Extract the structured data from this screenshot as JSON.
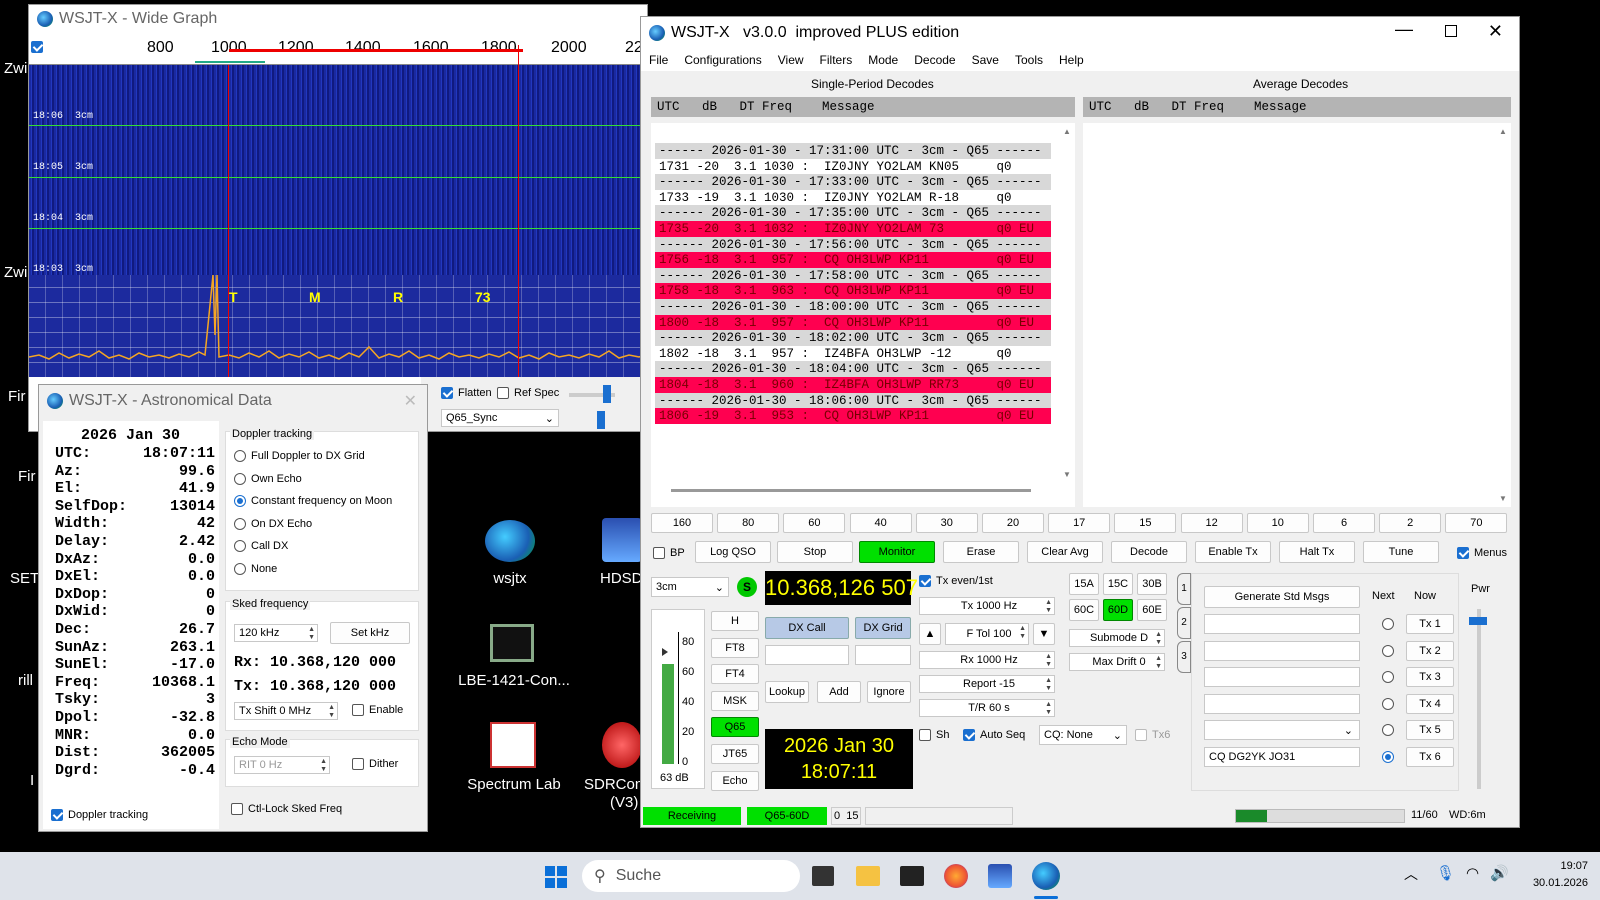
{
  "wide_graph": {
    "title": "WSJT-X - Wide Graph",
    "freq_ticks": [
      "800",
      "1000",
      "1200",
      "1400",
      "1600",
      "1800",
      "2000",
      "22"
    ],
    "time_labels": [
      "18:06  3cm",
      "18:05  3cm",
      "18:04  3cm",
      "18:03  3cm"
    ],
    "tone_labels": [
      "T",
      "M",
      "R",
      "73"
    ],
    "flatten_label": "Flatten",
    "ref_spec_label": "Ref Spec",
    "mode_select": "Q65_Sync",
    "left_edge_labels": [
      "Zwi",
      "Zwi",
      "Fir"
    ]
  },
  "astro": {
    "title": "WSJT-X - Astronomical Data",
    "date": "2026 Jan 30",
    "rows": [
      [
        "UTC:",
        "18:07:11"
      ],
      [
        "Az:",
        "99.6"
      ],
      [
        "El:",
        "41.9"
      ],
      [
        "SelfDop:",
        "13014"
      ],
      [
        "Width:",
        "42"
      ],
      [
        "Delay:",
        "2.42"
      ],
      [
        "DxAz:",
        "0.0"
      ],
      [
        "DxEl:",
        "0.0"
      ],
      [
        "DxDop:",
        "0"
      ],
      [
        "DxWid:",
        "0"
      ],
      [
        "Dec:",
        "26.7"
      ],
      [
        "SunAz:",
        "263.1"
      ],
      [
        "SunEl:",
        "-17.0"
      ],
      [
        "Freq:",
        "10368.1"
      ],
      [
        "Tsky:",
        "3"
      ],
      [
        "Dpol:",
        "-32.8"
      ],
      [
        "MNR:",
        "0.0"
      ],
      [
        "Dist:",
        "362005"
      ],
      [
        "Dgrd:",
        "-0.4"
      ]
    ],
    "doppler_tracking_check": "Doppler tracking",
    "doppler_group": "Doppler tracking",
    "doppler_options": [
      "Full Doppler to DX Grid",
      "Own Echo",
      "Constant frequency on Moon",
      "On DX Echo",
      "Call DX",
      "None"
    ],
    "sked_group": "Sked frequency",
    "sked_value": "120  kHz",
    "set_khz": "Set kHz",
    "rx": "Rx: 10.368,120 000",
    "tx": "Tx: 10.368,120 000",
    "tx_shift": "Tx Shift  0  MHz",
    "enable": "Enable",
    "echo_group": "Echo Mode",
    "rit": "RIT  0  Hz",
    "dither": "Dither",
    "ctl_lock": "Ctl-Lock Sked Freq"
  },
  "desktop": {
    "icons": [
      "wsjtx",
      "HDSD",
      "LBE-1421-Con...",
      "Spectrum Lab",
      "SDRCon",
      "(V3)"
    ],
    "left_labels": [
      "Fir",
      "SET",
      "rill",
      "I"
    ]
  },
  "main": {
    "title": "WSJT-X   v3.0.0  improved PLUS edition",
    "menu": [
      "File",
      "Configurations",
      "View",
      "Filters",
      "Mode",
      "Decode",
      "Save",
      "Tools",
      "Help"
    ],
    "single_title": "Single-Period Decodes",
    "average_title": "Average Decodes",
    "col_header": "UTC   dB   DT Freq    Message",
    "decodes": [
      {
        "t": "------ 2026-01-30 - 17:31:00 UTC - 3cm - Q65 ------",
        "k": "sep"
      },
      {
        "t": "1731 -20  3.1 1030 :  IZ0JNY YO2LAM KN05     q0",
        "k": ""
      },
      {
        "t": "------ 2026-01-30 - 17:33:00 UTC - 3cm - Q65 ------",
        "k": "sep"
      },
      {
        "t": "1733 -19  3.1 1030 :  IZ0JNY YO2LAM R-18     q0",
        "k": ""
      },
      {
        "t": "------ 2026-01-30 - 17:35:00 UTC - 3cm - Q65 ------",
        "k": "sep"
      },
      {
        "t": "1735 -20  3.1 1032 :  IZ0JNY YO2LAM 73       q0 EU",
        "k": "hl"
      },
      {
        "t": "------ 2026-01-30 - 17:56:00 UTC - 3cm - Q65 ------",
        "k": "sep"
      },
      {
        "t": "1756 -18  3.1  957 :  CQ OH3LWP KP11         q0 EU",
        "k": "hl"
      },
      {
        "t": "------ 2026-01-30 - 17:58:00 UTC - 3cm - Q65 ------",
        "k": "sep"
      },
      {
        "t": "1758 -18  3.1  963 :  CQ OH3LWP KP11         q0 EU",
        "k": "hl"
      },
      {
        "t": "------ 2026-01-30 - 18:00:00 UTC - 3cm - Q65 ------",
        "k": "sep"
      },
      {
        "t": "1800 -18  3.1  957 :  CQ OH3LWP KP11         q0 EU",
        "k": "hl"
      },
      {
        "t": "------ 2026-01-30 - 18:02:00 UTC - 3cm - Q65 ------",
        "k": "sep"
      },
      {
        "t": "1802 -18  3.1  957 :  IZ4BFA OH3LWP -12      q0",
        "k": ""
      },
      {
        "t": "------ 2026-01-30 - 18:04:00 UTC - 3cm - Q65 ------",
        "k": "sep"
      },
      {
        "t": "1804 -18  3.1  960 :  IZ4BFA OH3LWP RR73     q0 EU",
        "k": "hl"
      },
      {
        "t": "------ 2026-01-30 - 18:06:00 UTC - 3cm - Q65 ------",
        "k": "sep"
      },
      {
        "t": "1806 -19  3.1  953 :  CQ OH3LWP KP11         q0 EU",
        "k": "hl"
      }
    ],
    "bands": [
      "160",
      "80",
      "60",
      "40",
      "30",
      "20",
      "17",
      "15",
      "12",
      "10",
      "6",
      "2",
      "70"
    ],
    "buttons": {
      "bp": "BP",
      "log_qso": "Log QSO",
      "stop": "Stop",
      "monitor": "Monitor",
      "erase": "Erase",
      "clear_avg": "Clear Avg",
      "decode": "Decode",
      "enable_tx": "Enable Tx",
      "halt_tx": "Halt Tx",
      "tune": "Tune",
      "menus": "Menus"
    },
    "band_select": "3cm",
    "s_badge": "S",
    "frequency": "10.368,126 507",
    "mode_btns": [
      "H",
      "FT8",
      "FT4",
      "MSK",
      "Q65",
      "JT65",
      "Echo"
    ],
    "scale": [
      "80",
      "60",
      "40",
      "20",
      "0"
    ],
    "db_label": "63 dB",
    "dx_call": "DX Call",
    "dx_grid": "DX Grid",
    "lookup": "Lookup",
    "add": "Add",
    "ignore": "Ignore",
    "clock_date": "2026 Jan 30",
    "clock_time": "18:07:11",
    "tx_even": "Tx even/1st",
    "tx_hz": "Tx  1000  Hz",
    "ftol": "F Tol  100",
    "rx_hz": "Rx  1000  Hz",
    "report": "Report  -15",
    "tr": "T/R  60  s",
    "sh": "Sh",
    "auto_seq": "Auto Seq",
    "cq_none": "CQ: None",
    "tx6_check": "Tx6",
    "submodes": [
      "15A",
      "15C",
      "30B",
      "60C",
      "60D",
      "60E"
    ],
    "submode": "Submode  D",
    "max_drift": "Max Drift  0",
    "tab_nums": [
      "1",
      "2",
      "3"
    ],
    "gen_std": "Generate Std Msgs",
    "next": "Next",
    "now": "Now",
    "tx_btns": [
      "Tx 1",
      "Tx 2",
      "Tx 3",
      "Tx 4",
      "Tx 5",
      "Tx 6"
    ],
    "tx6_msg": "CQ DG2YK JO31",
    "pwr": "Pwr",
    "status": {
      "receiving": "Receiving",
      "mode": "Q65-60D",
      "count": "0  15",
      "progress": "11/60",
      "wd": "WD:6m"
    }
  },
  "taskbar": {
    "search": "Suche",
    "time": "19:07",
    "date": "30.01.2026"
  }
}
